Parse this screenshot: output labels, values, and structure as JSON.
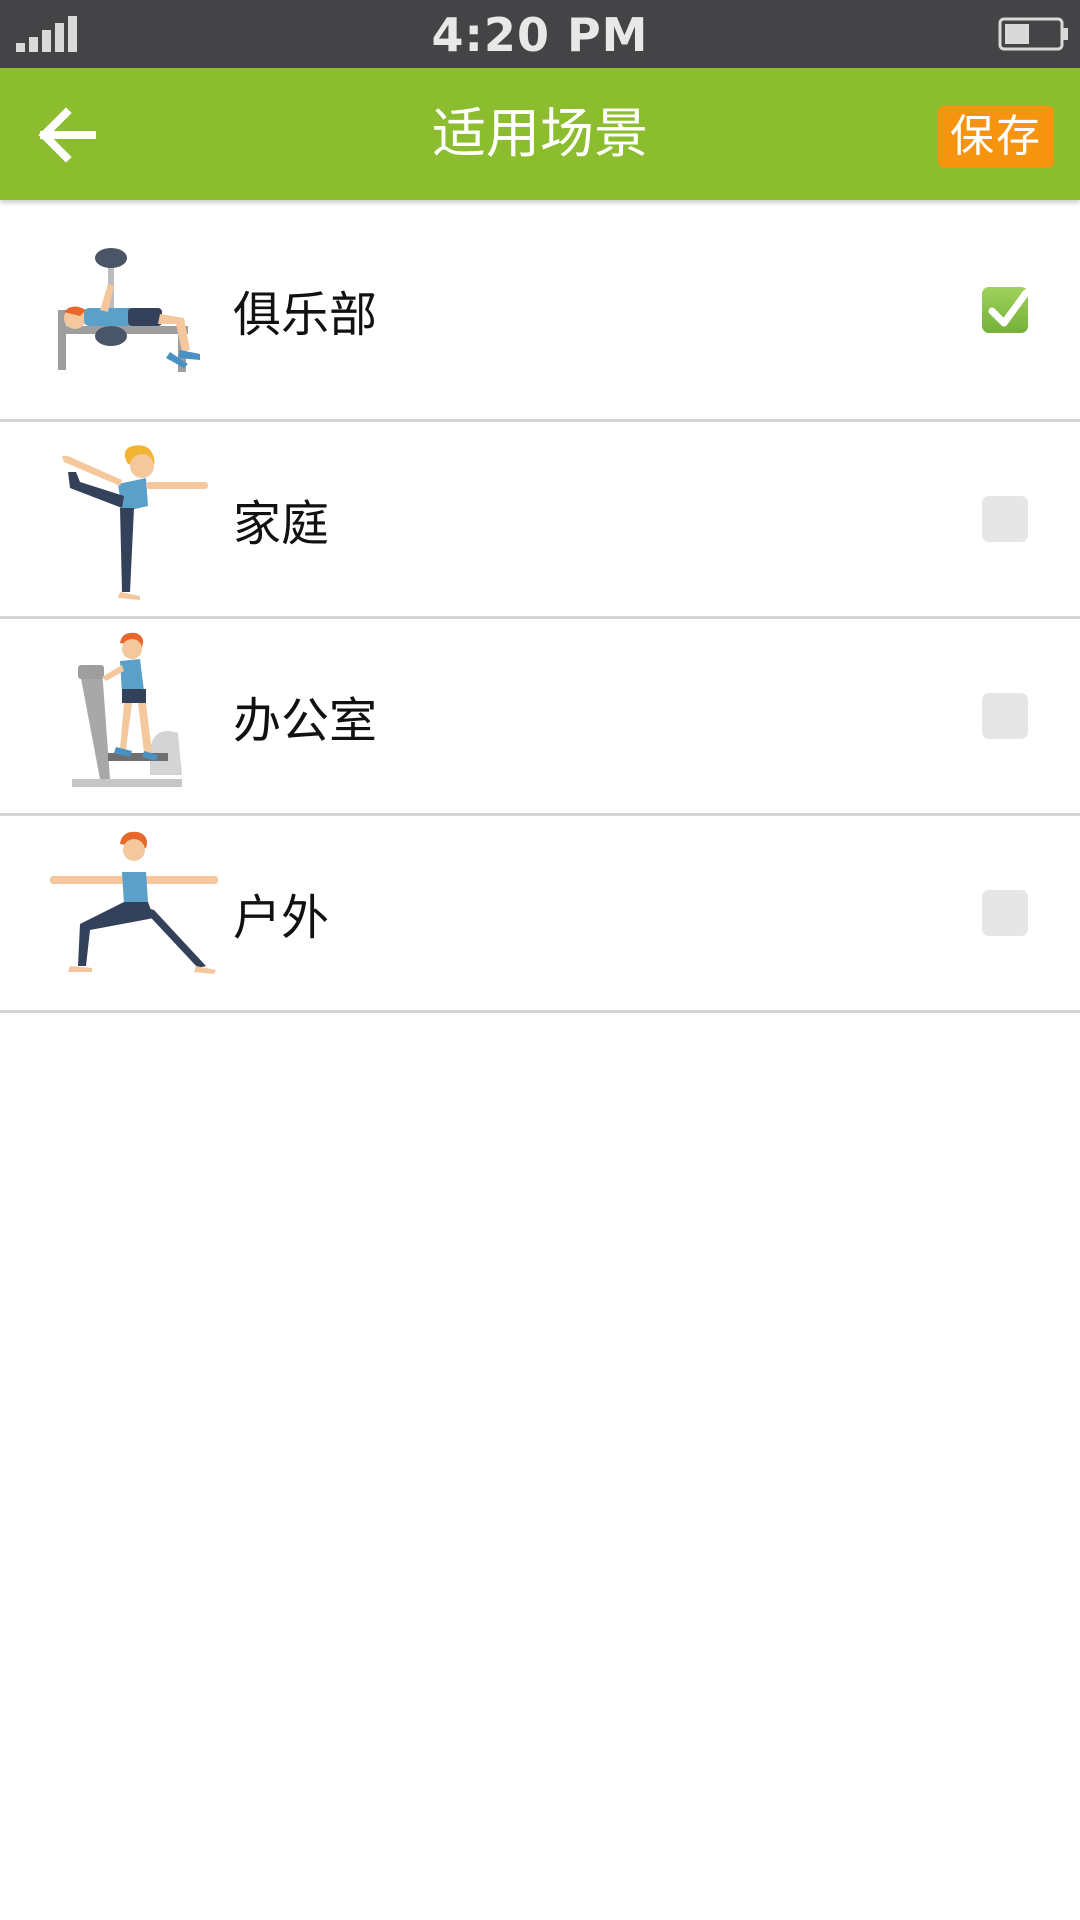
{
  "status_bar": {
    "time": "4:20 PM",
    "signal_icon": "signal-bars-icon",
    "battery_icon": "battery-icon"
  },
  "header": {
    "title": "适用场景",
    "back_icon": "arrow-left-icon",
    "save_label": "保存",
    "colors": {
      "bar": "#8bbd2e",
      "save": "#f6930f"
    }
  },
  "scenes": [
    {
      "label": "俱乐部",
      "illustration": "bench-press-illustration",
      "checked": true
    },
    {
      "label": "家庭",
      "illustration": "yoga-dancer-pose-illustration",
      "checked": false
    },
    {
      "label": "办公室",
      "illustration": "elliptical-trainer-illustration",
      "checked": false
    },
    {
      "label": "户外",
      "illustration": "warrior-pose-illustration",
      "checked": false
    }
  ]
}
